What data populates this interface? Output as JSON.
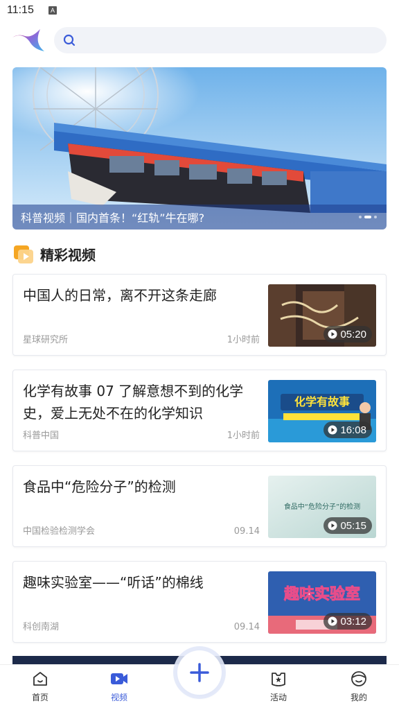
{
  "status_bar": {
    "time": "11:15",
    "indicator": "A"
  },
  "search": {
    "placeholder": ""
  },
  "banner": {
    "caption": "科普视频｜国内首条！“红轨”牛在哪?",
    "dots": 3,
    "active_dot": 2
  },
  "section": {
    "title": "精彩视频"
  },
  "videos": [
    {
      "title": "中国人的日常，离不开这条走廊",
      "source": "星球研究所",
      "time": "1小时前",
      "duration": "05:20",
      "thumb_text": ""
    },
    {
      "title": "化学有故事 07 了解意想不到的化学史，爱上无处不在的化学知识",
      "source": "科普中国",
      "time": "1小时前",
      "duration": "16:08",
      "thumb_text": "化学有故事"
    },
    {
      "title": "食品中“危险分子”的检测",
      "source": "中国检验检测学会",
      "time": "09.14",
      "duration": "05:15",
      "thumb_text": "食品中“危险分子”的检测"
    },
    {
      "title": "趣味实验室——“听话”的棉线",
      "source": "科创南湖",
      "time": "09.14",
      "duration": "03:12",
      "thumb_text": "趣味实验室"
    }
  ],
  "tabs": [
    {
      "label": "首页",
      "icon": "home-icon",
      "active": false
    },
    {
      "label": "视频",
      "icon": "video-icon",
      "active": true
    },
    {
      "label": "活动",
      "icon": "activity-icon",
      "active": false
    },
    {
      "label": "我的",
      "icon": "profile-icon",
      "active": false
    }
  ],
  "colors": {
    "accent": "#3a5bd9",
    "banner_caption_bg": "#1e3c8c",
    "section_icon": "#f5a623"
  }
}
